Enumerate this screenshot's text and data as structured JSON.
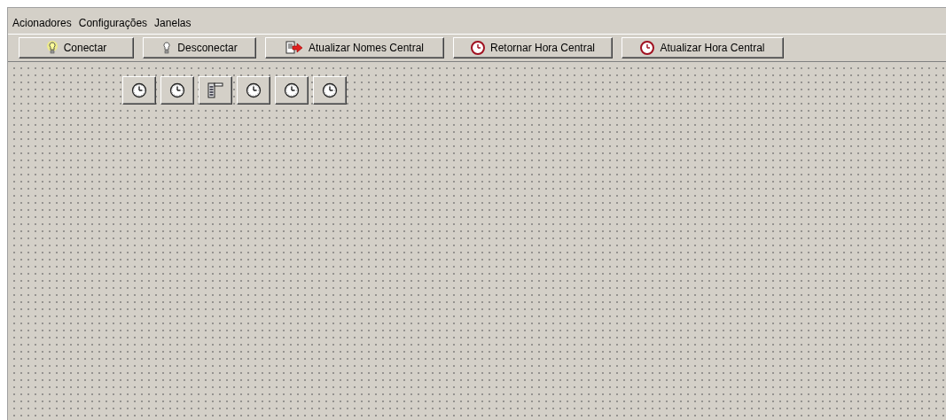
{
  "menu": [
    "Acionadores",
    "Configurações",
    "Janelas"
  ],
  "toolbar": [
    {
      "label": "Conectar",
      "kind": "bulb-on"
    },
    {
      "label": "Desconectar",
      "kind": "bulb-off"
    },
    {
      "label": "Atualizar Nomes Central",
      "kind": "doc-arrow"
    },
    {
      "label": "Retornar Hora Central",
      "kind": "red-clock"
    },
    {
      "label": "Atualizar Hora Central",
      "kind": "red-clock"
    }
  ],
  "canvas_icons": [
    {
      "kind": "clock"
    },
    {
      "kind": "clock"
    },
    {
      "kind": "list"
    },
    {
      "kind": "clock"
    },
    {
      "kind": "clock"
    },
    {
      "kind": "clock"
    }
  ]
}
